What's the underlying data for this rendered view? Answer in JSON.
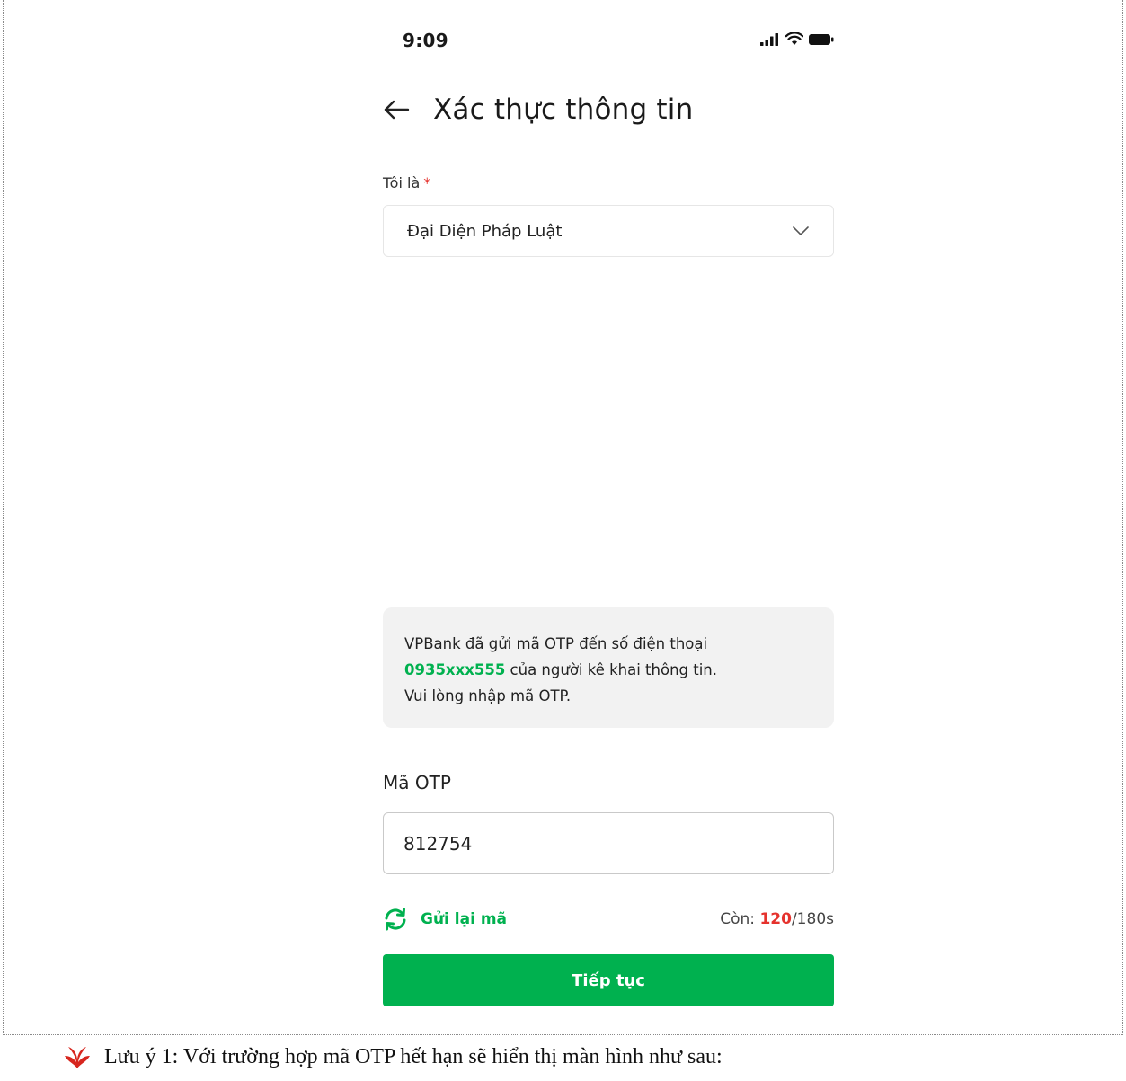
{
  "status_bar": {
    "time": "9:09",
    "icons": [
      "signal-icon",
      "wifi-icon",
      "battery-icon"
    ]
  },
  "header": {
    "back_icon": "arrow-left-icon",
    "title": "Xác thực thông tin"
  },
  "role_field": {
    "label": "Tôi là",
    "required_mark": "*",
    "selected_value": "Đại Diện Pháp Luật",
    "dropdown_icon": "chevron-down-icon"
  },
  "notice": {
    "text_before": "VPBank đã gửi mã OTP đến số điện thoại",
    "phone_number": "0935xxx555",
    "text_after": " của người kê khai thông tin.",
    "instruction": "Vui lòng nhập mã OTP."
  },
  "otp": {
    "label": "Mã OTP",
    "value": "812754"
  },
  "resend": {
    "icon": "refresh-icon",
    "label": "Gửi lại mã"
  },
  "timer": {
    "prefix": "Còn: ",
    "remaining": "120",
    "total": "/180s"
  },
  "continue_button": {
    "label": "Tiếp tục"
  },
  "doc_note": {
    "icon": "red-leaf-bullet-icon",
    "text": "Lưu ý 1: Với trường hợp mã OTP hết hạn sẽ hiển thị màn hình như sau:"
  },
  "colors": {
    "brand_green": "#00b14f",
    "error_red": "#e5322d",
    "notice_bg": "#f2f2f2"
  }
}
